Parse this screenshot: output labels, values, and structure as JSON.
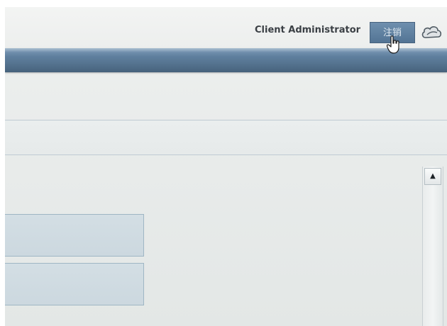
{
  "header": {
    "user_name": "Client Administrator",
    "logout_label": "注销",
    "logo_icon": "cloud-icon"
  },
  "colors": {
    "banner": "#5f7f9e",
    "logout_button": "#5f7fa0",
    "panel": "#cfdbe1",
    "background": "#eceeed"
  },
  "scrollbar": {
    "up_arrow": "▲"
  },
  "panels": [
    {
      "label": ""
    },
    {
      "label": ""
    }
  ]
}
